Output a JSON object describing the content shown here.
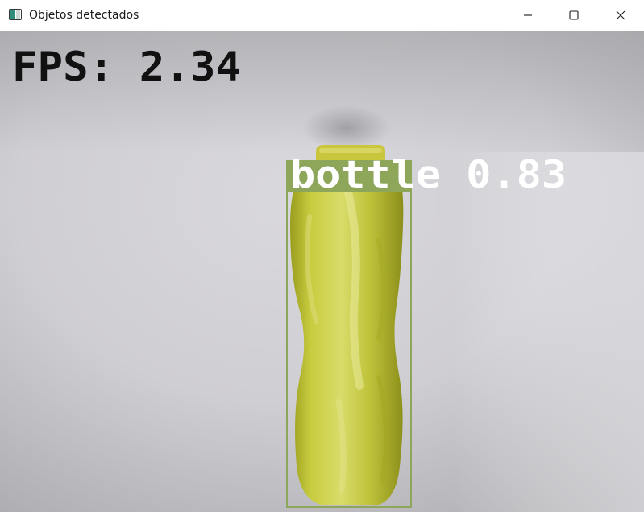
{
  "window": {
    "title": "Objetos detectados",
    "buttons": {
      "minimize": "minimize",
      "maximize": "maximize",
      "close": "close"
    }
  },
  "frame": {
    "fps_label": "FPS: 2.34",
    "detections": [
      {
        "label": "bottle 0.83",
        "class": "bottle",
        "confidence": 0.83,
        "box_color": "#8da65a"
      }
    ]
  }
}
